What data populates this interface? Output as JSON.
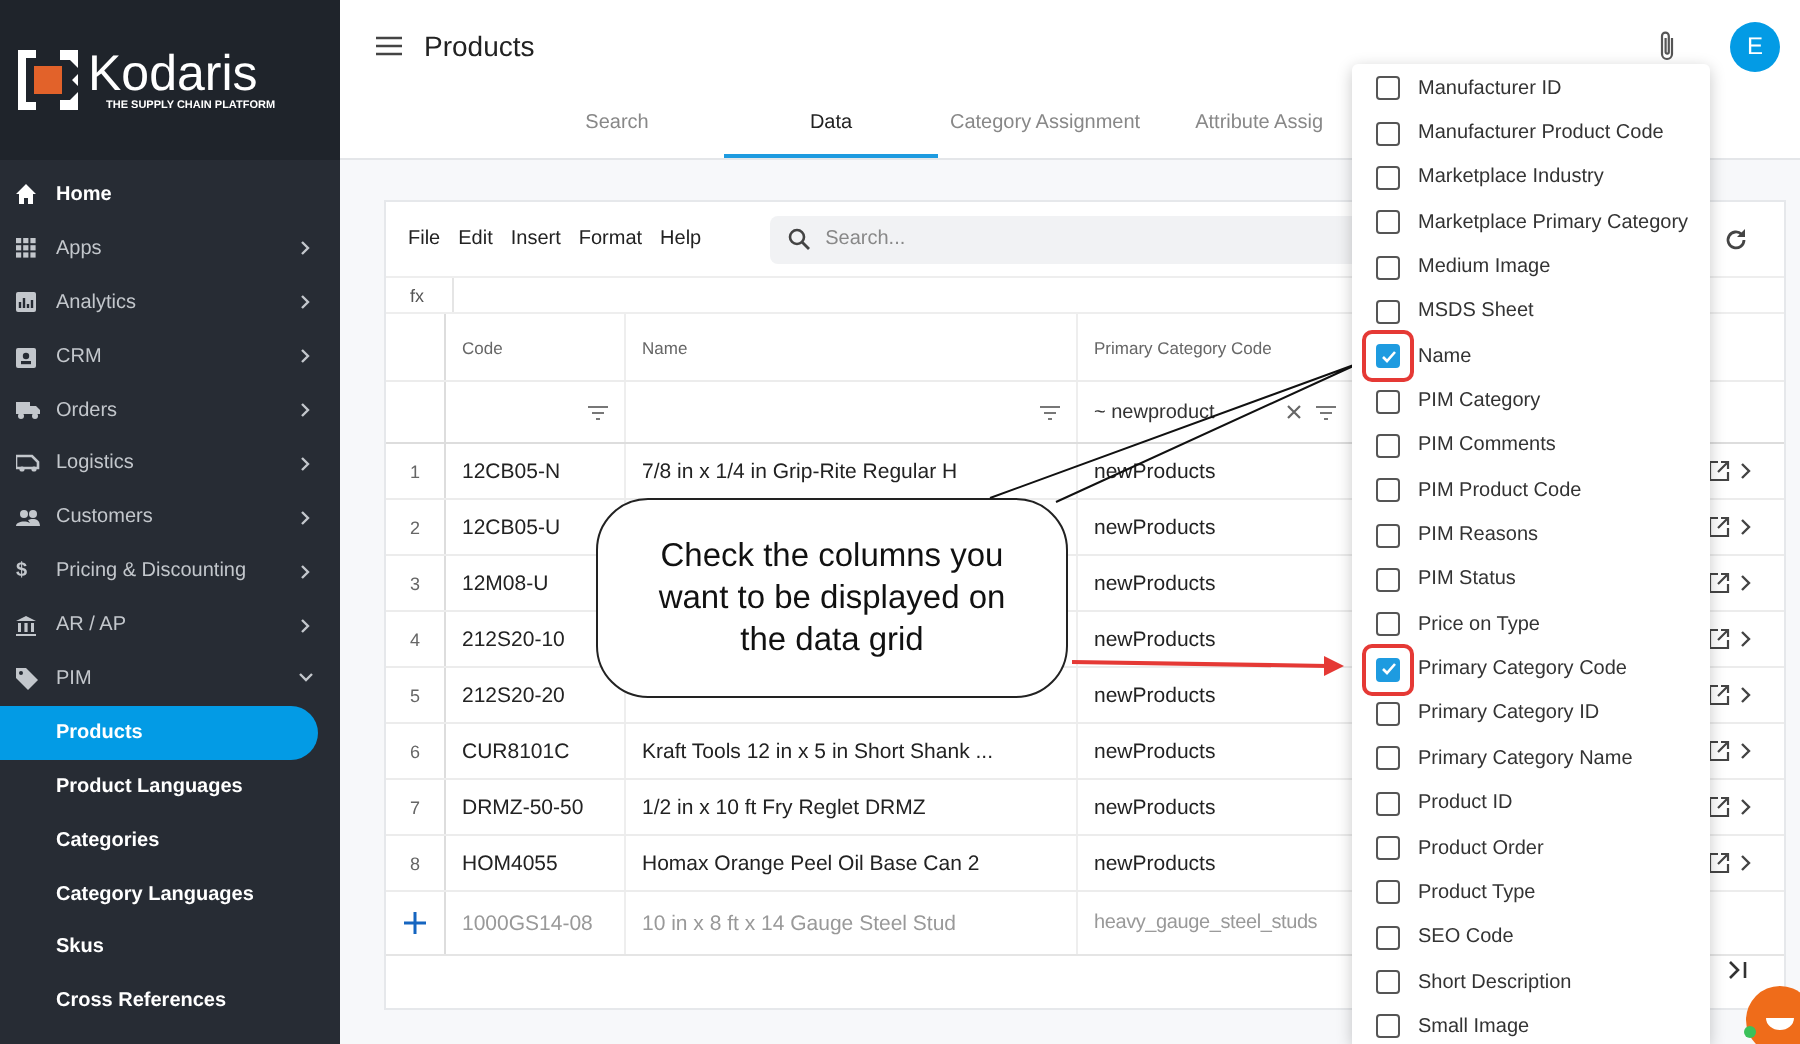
{
  "logo": {
    "name": "Kodaris",
    "tagline": "THE SUPPLY CHAIN PLATFORM"
  },
  "sidebar": {
    "items": [
      {
        "label": "Home"
      },
      {
        "label": "Apps",
        "expanded": false
      },
      {
        "label": "Analytics",
        "expanded": false
      },
      {
        "label": "CRM",
        "expanded": false
      },
      {
        "label": "Orders",
        "expanded": false
      },
      {
        "label": "Logistics",
        "expanded": false
      },
      {
        "label": "Customers",
        "expanded": false
      },
      {
        "label": "Pricing & Discounting",
        "icon_text": "$",
        "expanded": false
      },
      {
        "label": "AR / AP",
        "expanded": false
      },
      {
        "label": "PIM",
        "expanded": true,
        "children": [
          {
            "label": "Products",
            "selected": true
          },
          {
            "label": "Product Languages",
            "selected": false
          },
          {
            "label": "Categories",
            "selected": false
          },
          {
            "label": "Category Languages",
            "selected": false
          },
          {
            "label": "Skus",
            "selected": false
          },
          {
            "label": "Cross References",
            "selected": false
          }
        ]
      }
    ]
  },
  "header": {
    "title": "Products",
    "avatar": "E"
  },
  "tabs": [
    {
      "label": "Search",
      "selected": false
    },
    {
      "label": "Data",
      "selected": true
    },
    {
      "label": "Category Assignment",
      "selected": false
    },
    {
      "label": "Attribute Assig",
      "selected": false
    }
  ],
  "toolbar": {
    "menu": [
      "File",
      "Edit",
      "Insert",
      "Format",
      "Help"
    ],
    "search": {
      "placeholder": "Search..."
    },
    "formula_label": "fx"
  },
  "table": {
    "columns": [
      {
        "label": "Code"
      },
      {
        "label": "Name"
      },
      {
        "label": "Primary Category Code",
        "filter": "~ newproduct"
      }
    ],
    "rows": [
      {
        "number": "1",
        "code": "12CB05-N",
        "name": "7/8 in x 1/4 in Grip-Rite Regular H",
        "category": "newProducts"
      },
      {
        "number": "2",
        "code": "12CB05-U",
        "category": "newProducts"
      },
      {
        "number": "3",
        "code": "12M08-U",
        "category": "newProducts"
      },
      {
        "number": "4",
        "code": "212S20-10",
        "category": "newProducts"
      },
      {
        "number": "5",
        "code": "212S20-20",
        "category": "newProducts"
      },
      {
        "number": "6",
        "code": "CUR8101C",
        "name": "Kraft Tools 12 in x 5 in Short Shank ...",
        "category": "newProducts"
      },
      {
        "number": "7",
        "code": "DRMZ-50-50",
        "name": "1/2 in x 10 ft Fry Reglet DRMZ",
        "category": "newProducts"
      },
      {
        "number": "8",
        "code": "HOM4055",
        "name": "Homax Orange Peel Oil Base Can 2",
        "category": "newProducts"
      }
    ],
    "new_row": {
      "code": "1000GS14-08",
      "name": "10 in x 8 ft x 14 Gauge Steel Stud",
      "category": "heavy_gauge_steel_studs"
    }
  },
  "callout": {
    "text": "Check the columns you want to be displayed on the data grid"
  },
  "column_menu": {
    "items": [
      {
        "label": "Manufacturer ID",
        "checked": false,
        "annotated": false
      },
      {
        "label": "Manufacturer Product Code",
        "checked": false,
        "annotated": false
      },
      {
        "label": "Marketplace Industry",
        "checked": false,
        "annotated": false
      },
      {
        "label": "Marketplace Primary Category",
        "checked": false,
        "annotated": false
      },
      {
        "label": "Medium Image",
        "checked": false,
        "annotated": false
      },
      {
        "label": "MSDS Sheet",
        "checked": false,
        "annotated": false
      },
      {
        "label": "Name",
        "checked": true,
        "annotated": true
      },
      {
        "label": "PIM Category",
        "checked": false,
        "annotated": false
      },
      {
        "label": "PIM Comments",
        "checked": false,
        "annotated": false
      },
      {
        "label": "PIM Product Code",
        "checked": false,
        "annotated": false
      },
      {
        "label": "PIM Reasons",
        "checked": false,
        "annotated": false
      },
      {
        "label": "PIM Status",
        "checked": false,
        "annotated": false
      },
      {
        "label": "Price on Type",
        "checked": false,
        "annotated": false
      },
      {
        "label": "Primary Category Code",
        "checked": true,
        "annotated": true
      },
      {
        "label": "Primary Category ID",
        "checked": false,
        "annotated": false
      },
      {
        "label": "Primary Category Name",
        "checked": false,
        "annotated": false
      },
      {
        "label": "Product ID",
        "checked": false,
        "annotated": false
      },
      {
        "label": "Product Order",
        "checked": false,
        "annotated": false
      },
      {
        "label": "Product Type",
        "checked": false,
        "annotated": false
      },
      {
        "label": "SEO Code",
        "checked": false,
        "annotated": false
      },
      {
        "label": "Short Description",
        "checked": false,
        "annotated": false
      },
      {
        "label": "Small Image",
        "checked": false,
        "annotated": false
      }
    ]
  }
}
